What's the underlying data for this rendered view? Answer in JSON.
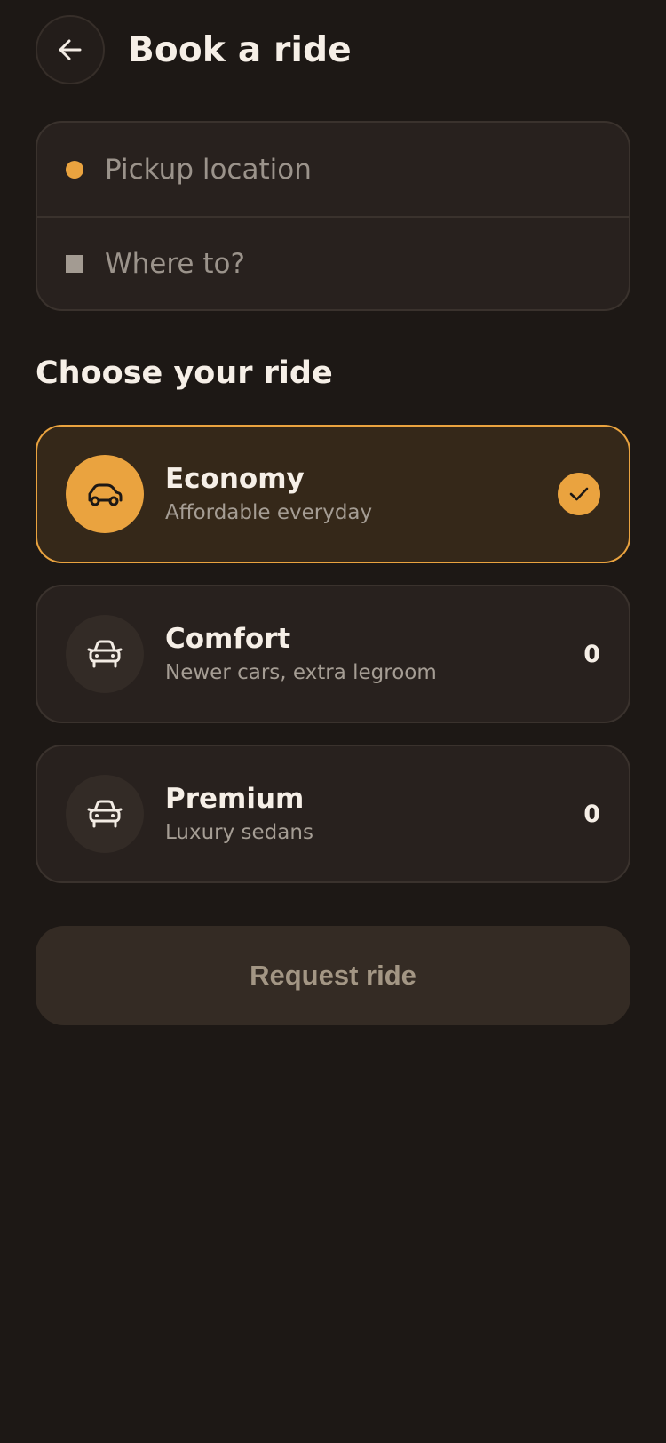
{
  "header": {
    "title": "Book a ride",
    "back_icon": "arrow-left-icon"
  },
  "location": {
    "pickup_placeholder": "Pickup location",
    "pickup_value": "",
    "destination_placeholder": "Where to?",
    "destination_value": ""
  },
  "section": {
    "title": "Choose your ride"
  },
  "rides": [
    {
      "name": "Economy",
      "description": "Affordable everyday",
      "selected": true,
      "icon": "car-side-icon",
      "price": ""
    },
    {
      "name": "Comfort",
      "description": "Newer cars, extra legroom",
      "selected": false,
      "icon": "car-front-icon",
      "price": "0"
    },
    {
      "name": "Premium",
      "description": "Luxury sedans",
      "selected": false,
      "icon": "car-front-icon",
      "price": "0"
    }
  ],
  "request": {
    "label": "Request ride"
  },
  "colors": {
    "background": "#1d1815",
    "card": "#28211e",
    "accent": "#eaa33f",
    "selected_card": "#352819",
    "button_disabled": "#342b24"
  }
}
